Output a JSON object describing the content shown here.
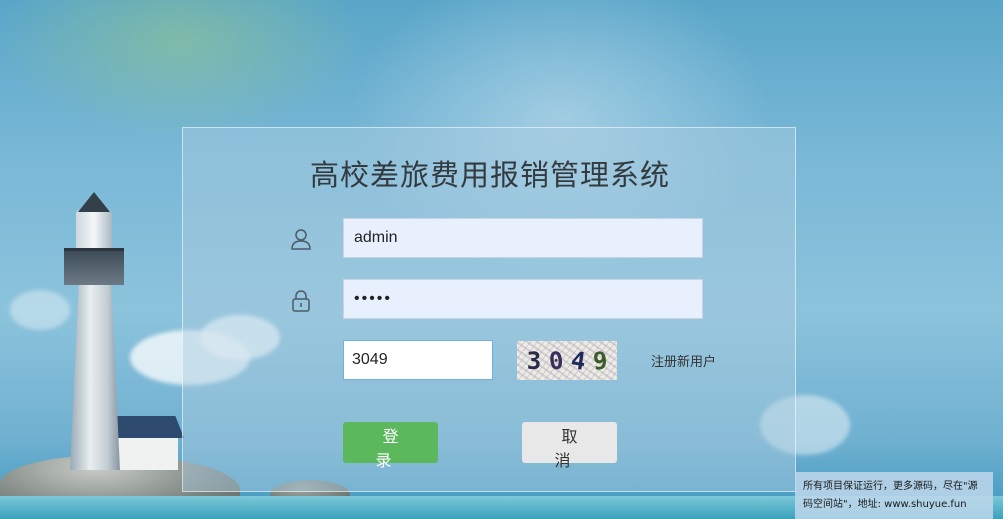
{
  "app": {
    "title": "高校差旅费用报销管理系统"
  },
  "login": {
    "username_value": "admin",
    "password_value": "•••••",
    "code_value": "3049",
    "captcha_chars": [
      "3",
      "0",
      "4",
      "9"
    ],
    "register_label": "注册新用户",
    "login_button": "登 录",
    "cancel_button": "取 消"
  },
  "icons": {
    "user": "user-icon",
    "lock": "lock-icon"
  },
  "footer": {
    "note": "所有项目保证运行，更多源码，尽在\"源码空间站\"，地址: www.shuyue.fun"
  },
  "colors": {
    "login_button": "#5cb85c",
    "cancel_button": "#e8e8e8",
    "input_background": "#e8f0fe"
  }
}
